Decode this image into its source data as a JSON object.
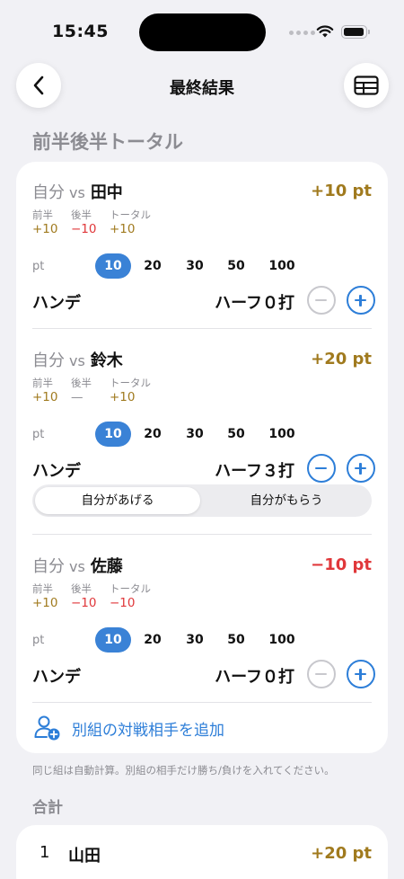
{
  "status_bar": {
    "time": "15:45"
  },
  "nav": {
    "title": "最終結果",
    "back_icon": "chevron-left-icon",
    "table_icon": "table-icon"
  },
  "section_title": "前半後半トータル",
  "labels": {
    "first_half": "前半",
    "second_half": "後半",
    "total": "トータル",
    "me": "自分",
    "vs": "vs",
    "pt": "pt",
    "hande": "ハンデ"
  },
  "pt_options": [
    "10",
    "20",
    "30",
    "50",
    "100"
  ],
  "matches": [
    {
      "opponent": "田中",
      "total": "+10 pt",
      "first_half": "+10",
      "second_half": "−10",
      "overall": "+10",
      "selected_pt": "10",
      "hande_value": "ハーフ０打"
    },
    {
      "opponent": "鈴木",
      "total": "+20 pt",
      "first_half": "+10",
      "second_half": "—",
      "overall": "+10",
      "selected_pt": "10",
      "hande_value": "ハーフ３打",
      "segment": {
        "give": "自分があげる",
        "receive": "自分がもらう",
        "selected": "自分があげる"
      }
    },
    {
      "opponent": "佐藤",
      "total": "−10 pt",
      "first_half": "+10",
      "second_half": "−10",
      "overall": "−10",
      "selected_pt": "10",
      "hande_value": "ハーフ０打"
    }
  ],
  "add_opponent": {
    "label": "別組の対戦相手を追加",
    "icon": "add-person-icon"
  },
  "note": "同じ組は自動計算。別組の相手だけ勝ち/負けを入れてください。",
  "summary": {
    "title": "合計",
    "rows": [
      {
        "rank": "1",
        "name": "山田",
        "total": "+20 pt"
      }
    ]
  },
  "colors": {
    "accent": "#2d7ed8",
    "positive": "#a07a1e",
    "negative": "#e0373a",
    "muted": "#8c8c92",
    "background": "#f1f1f5"
  }
}
